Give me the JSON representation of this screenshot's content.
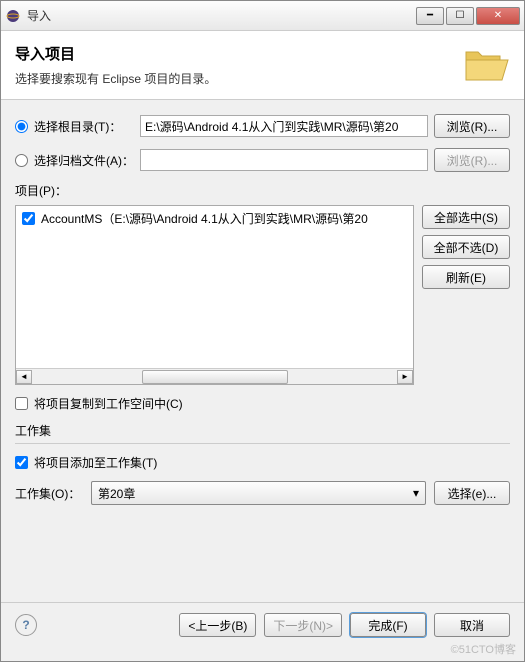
{
  "window": {
    "title": "导入"
  },
  "header": {
    "title": "导入项目",
    "subtitle": "选择要搜索现有 Eclipse 项目的目录。"
  },
  "radios": {
    "root": "选择根目录(T)：",
    "archive": "选择归档文件(A)："
  },
  "inputs": {
    "root_value": "E:\\源码\\Android 4.1从入门到实践\\MR\\源码\\第20",
    "archive_value": ""
  },
  "buttons": {
    "browse_root": "浏览(R)...",
    "browse_archive": "浏览(R)...",
    "select_all": "全部选中(S)",
    "deselect_all": "全部不选(D)",
    "refresh": "刷新(E)",
    "select_ws": "选择(e)...",
    "back": "<上一步(B)",
    "next": "下一步(N)>",
    "finish": "完成(F)",
    "cancel": "取消"
  },
  "labels": {
    "projects": "项目(P)：",
    "copy_to_ws": "将项目复制到工作空间中(C)",
    "working_sets": "工作集",
    "add_to_ws": "将项目添加至工作集(T)",
    "ws_label": "工作集(O)："
  },
  "projects": {
    "items": [
      {
        "checked": true,
        "label": "AccountMS（E:\\源码\\Android 4.1从入门到实践\\MR\\源码\\第20"
      }
    ]
  },
  "working_set_selected": "第20章",
  "watermark": "©51CTO博客"
}
